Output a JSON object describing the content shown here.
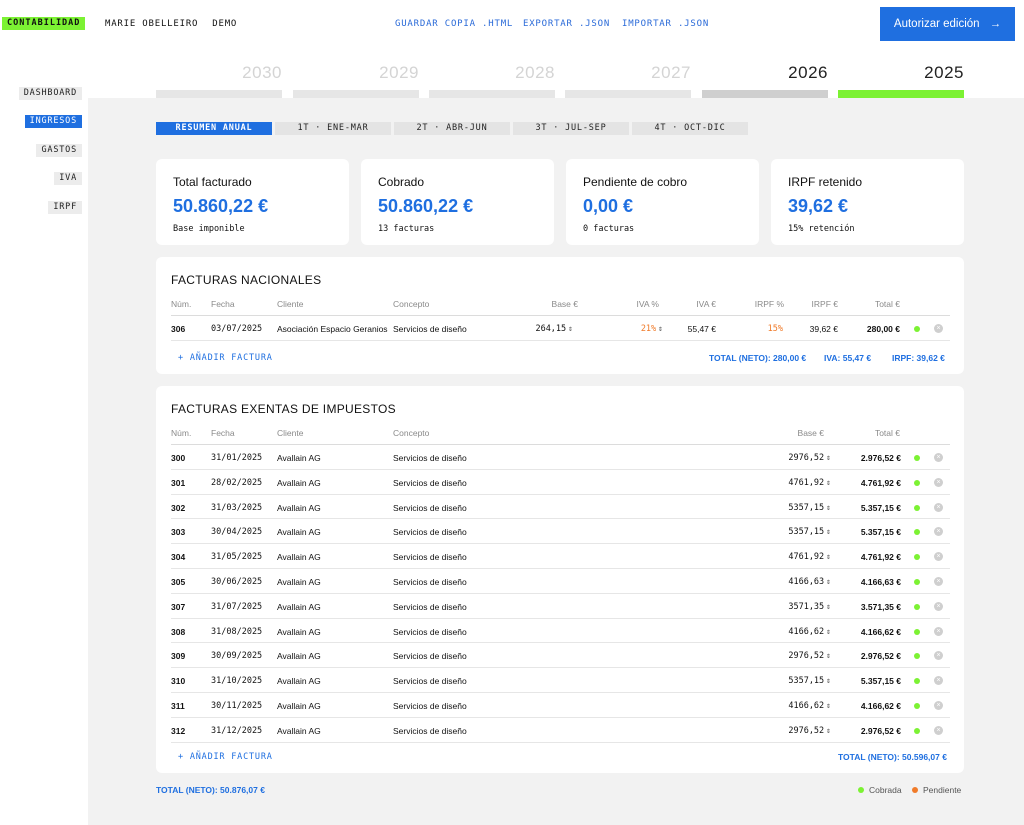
{
  "header": {
    "brand": "CONTABILIDAD",
    "user_name": "MARIE OBELLEIRO",
    "user_mode": "DEMO",
    "nav": [
      "GUARDAR COPIA .HTML",
      "EXPORTAR .JSON",
      "IMPORTAR .JSON"
    ],
    "auth_button": "Autorizar edición",
    "auth_icon": "→"
  },
  "sidebar": {
    "items": [
      "DASHBOARD",
      "INGRESOS",
      "GASTOS",
      "IVA",
      "IRPF"
    ],
    "active": "INGRESOS"
  },
  "years": [
    "2030",
    "2029",
    "2028",
    "2027",
    "2026",
    "2025"
  ],
  "active_year": "2025",
  "quarters": [
    "RESUMEN ANUAL",
    "1T · ENE-MAR",
    "2T · ABR-JUN",
    "3T · JUL-SEP",
    "4T · OCT-DIC"
  ],
  "kpis": [
    {
      "label": "Total facturado",
      "value": "50.860,22 €",
      "sub": "Base imponible"
    },
    {
      "label": "Cobrado",
      "value": "50.860,22 €",
      "sub": "13 facturas"
    },
    {
      "label": "Pendiente de cobro",
      "value": "0,00 €",
      "sub": "0 facturas"
    },
    {
      "label": "IRPF retenido",
      "value": "39,62 €",
      "sub": "15% retención"
    }
  ],
  "nacionales": {
    "title": "FACTURAS NACIONALES",
    "headers": [
      "Núm.",
      "Fecha",
      "Cliente",
      "Concepto",
      "Base €",
      "IVA %",
      "IVA €",
      "IRPF %",
      "IRPF €",
      "Total €"
    ],
    "rows": [
      {
        "num": "306",
        "fecha": "03/07/2025",
        "cliente": "Asociación Espacio Geranios",
        "concepto": "Servicios de diseño",
        "base": "264,15",
        "iva_pct": "21%",
        "iva": "55,47 €",
        "irpf_pct": "15%",
        "irpf": "39,62 €",
        "total": "280,00 €"
      }
    ],
    "add_label": "+ AÑADIR FACTURA",
    "total_neto": "TOTAL (NETO): 280,00 €",
    "total_iva": "IVA: 55,47 €",
    "total_irpf": "IRPF: 39,62 €"
  },
  "exentas": {
    "title": "FACTURAS EXENTAS DE IMPUESTOS",
    "headers": [
      "Núm.",
      "Fecha",
      "Cliente",
      "Concepto",
      "Base €",
      "Total €"
    ],
    "rows": [
      {
        "num": "300",
        "fecha": "31/01/2025",
        "cliente": "Avallain AG",
        "concepto": "Servicios de diseño",
        "base": "2976,52",
        "total": "2.976,52 €"
      },
      {
        "num": "301",
        "fecha": "28/02/2025",
        "cliente": "Avallain AG",
        "concepto": "Servicios de diseño",
        "base": "4761,92",
        "total": "4.761,92 €"
      },
      {
        "num": "302",
        "fecha": "31/03/2025",
        "cliente": "Avallain AG",
        "concepto": "Servicios de diseño",
        "base": "5357,15",
        "total": "5.357,15 €"
      },
      {
        "num": "303",
        "fecha": "30/04/2025",
        "cliente": "Avallain AG",
        "concepto": "Servicios de diseño",
        "base": "5357,15",
        "total": "5.357,15 €"
      },
      {
        "num": "304",
        "fecha": "31/05/2025",
        "cliente": "Avallain AG",
        "concepto": "Servicios de diseño",
        "base": "4761,92",
        "total": "4.761,92 €"
      },
      {
        "num": "305",
        "fecha": "30/06/2025",
        "cliente": "Avallain AG",
        "concepto": "Servicios de diseño",
        "base": "4166,63",
        "total": "4.166,63 €"
      },
      {
        "num": "307",
        "fecha": "31/07/2025",
        "cliente": "Avallain AG",
        "concepto": "Servicios de diseño",
        "base": "3571,35",
        "total": "3.571,35 €"
      },
      {
        "num": "308",
        "fecha": "31/08/2025",
        "cliente": "Avallain AG",
        "concepto": "Servicios de diseño",
        "base": "4166,62",
        "total": "4.166,62 €"
      },
      {
        "num": "309",
        "fecha": "30/09/2025",
        "cliente": "Avallain AG",
        "concepto": "Servicios de diseño",
        "base": "2976,52",
        "total": "2.976,52 €"
      },
      {
        "num": "310",
        "fecha": "31/10/2025",
        "cliente": "Avallain AG",
        "concepto": "Servicios de diseño",
        "base": "5357,15",
        "total": "5.357,15 €"
      },
      {
        "num": "311",
        "fecha": "30/11/2025",
        "cliente": "Avallain AG",
        "concepto": "Servicios de diseño",
        "base": "4166,62",
        "total": "4.166,62 €"
      },
      {
        "num": "312",
        "fecha": "31/12/2025",
        "cliente": "Avallain AG",
        "concepto": "Servicios de diseño",
        "base": "2976,52",
        "total": "2.976,52 €"
      }
    ],
    "add_label": "+ AÑADIR FACTURA",
    "total_neto": "TOTAL (NETO): 50.596,07 €"
  },
  "footer": {
    "total": "TOTAL (NETO): 50.876,07 €",
    "legend": [
      {
        "label": "Cobrada",
        "color": "#7cf233"
      },
      {
        "label": "Pendiente",
        "color": "#f07b2a"
      }
    ]
  },
  "icons": {
    "stepper": "stepper-icon",
    "status": "status-dot-icon",
    "delete": "close-icon"
  },
  "colors": {
    "accent": "#1f6fe0",
    "brand": "#7cf233",
    "warning": "#f07b2a"
  }
}
